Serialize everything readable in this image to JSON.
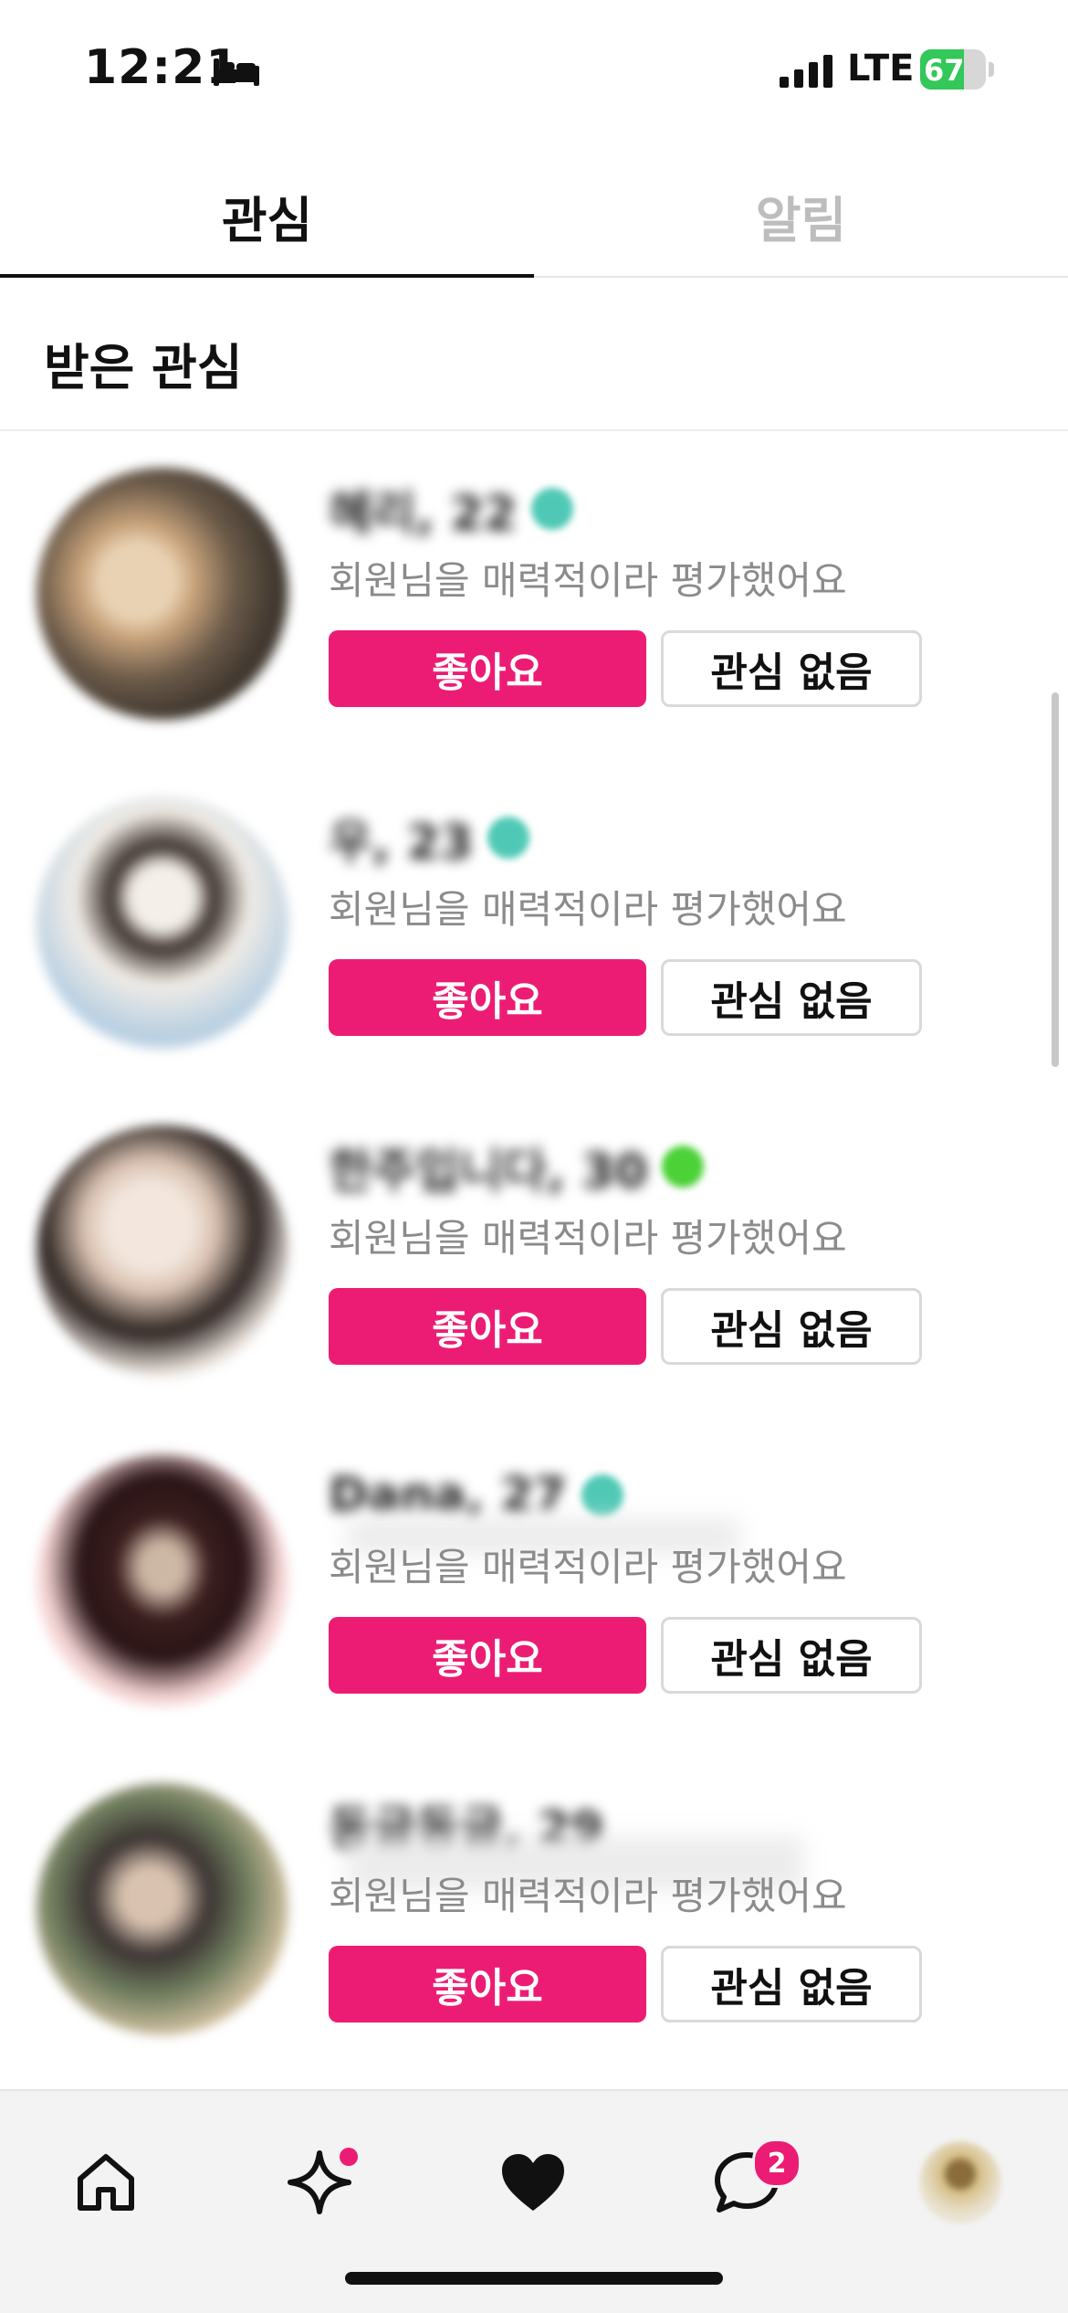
{
  "status_bar": {
    "time": "12:21",
    "network": "LTE",
    "battery": "67",
    "battery_level": 0.67,
    "icons": [
      "bed-icon",
      "signal-icon",
      "battery-charging-icon"
    ]
  },
  "tabs": [
    {
      "label": "관심",
      "active": true
    },
    {
      "label": "알림",
      "active": false
    }
  ],
  "section": {
    "title": "받은 관심"
  },
  "items": [
    {
      "name": "혜리, 22",
      "description": "회원님을 매력적이라 평가했어요",
      "like_label": "좋아요",
      "pass_label": "관심 없음",
      "verify_color": "#4fc9b5"
    },
    {
      "name": "우, 23",
      "description": "회원님을 매력적이라 평가했어요",
      "like_label": "좋아요",
      "pass_label": "관심 없음",
      "verify_color": "#4fc9b5"
    },
    {
      "name": "한주입니다, 30",
      "description": "회원님을 매력적이라 평가했어요",
      "like_label": "좋아요",
      "pass_label": "관심 없음",
      "verify_color": "#4cd137"
    },
    {
      "name": "Dana, 27",
      "description": "회원님을 매력적이라 평가했어요",
      "like_label": "좋아요",
      "pass_label": "관심 없음",
      "verify_color": "#4fc9b5"
    },
    {
      "name": "동글동글, 29",
      "description": "회원님을 매력적이라 평가했어요",
      "like_label": "좋아요",
      "pass_label": "관심 없음",
      "verify_color": "#ffffff"
    }
  ],
  "bottom_nav": {
    "items": [
      {
        "icon": "home-icon"
      },
      {
        "icon": "sparkle-icon",
        "has_dot": true
      },
      {
        "icon": "heart-icon",
        "active": true
      },
      {
        "icon": "chat-icon",
        "badge": "2"
      },
      {
        "icon": "profile-avatar"
      }
    ]
  },
  "colors": {
    "accent": "#ec1c74",
    "muted_text": "#8b8b8b",
    "inactive_tab": "#bdbdbd",
    "battery_green": "#34c759"
  }
}
